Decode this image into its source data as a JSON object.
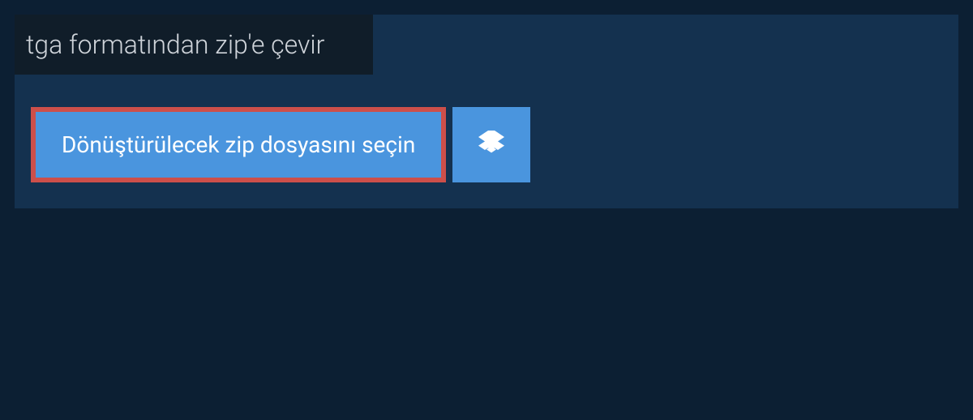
{
  "heading": "tga formatından zip'e çevir",
  "select_button_label": "Dönüştürülecek zip dosyasını seçin"
}
